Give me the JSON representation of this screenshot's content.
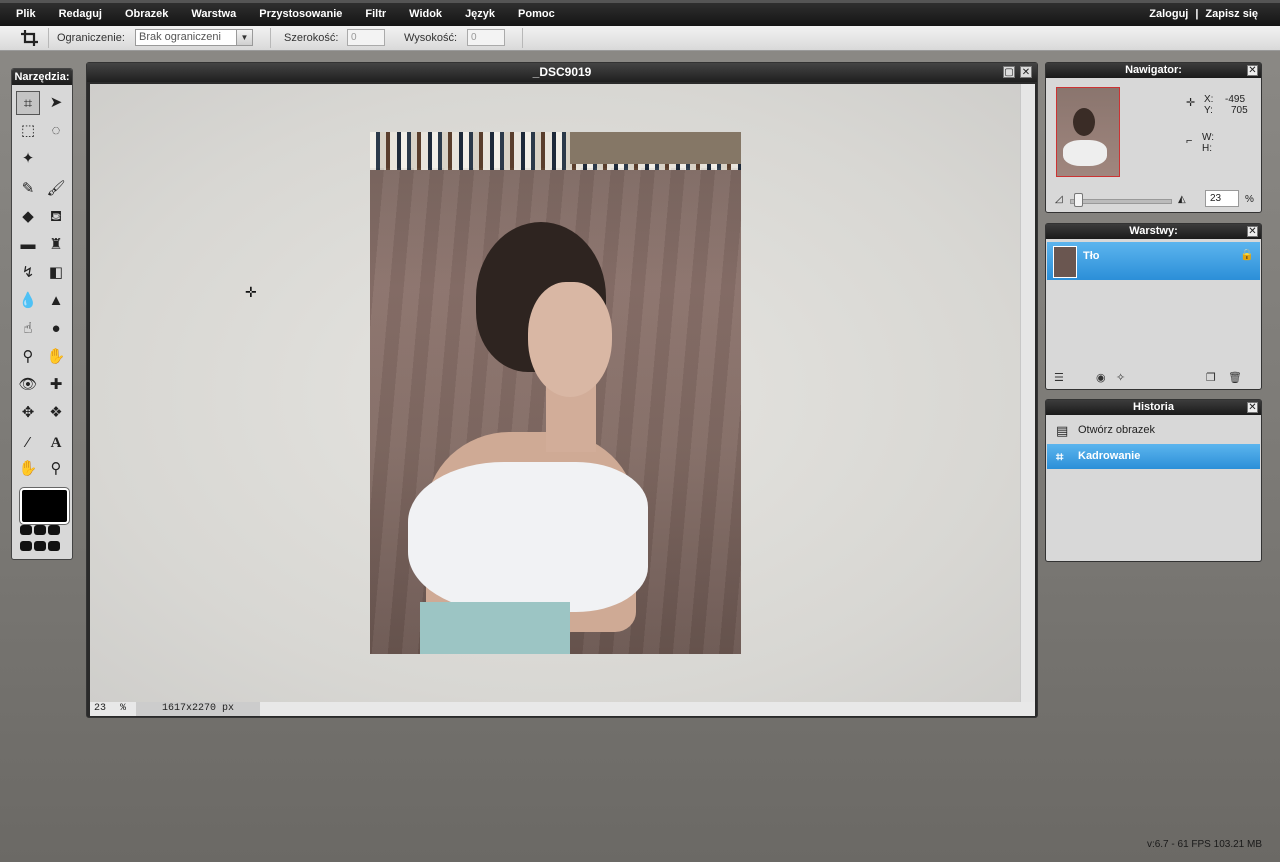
{
  "menu": {
    "items": [
      "Plik",
      "Redaguj",
      "Obrazek",
      "Warstwa",
      "Przystosowanie",
      "Filtr",
      "Widok",
      "Język",
      "Pomoc"
    ],
    "login": "Zaloguj",
    "separator": "|",
    "signup": "Zapisz się"
  },
  "options": {
    "constraint_label": "Ograniczenie:",
    "constraint_value": "Brak ograniczeni",
    "width_label": "Szerokość:",
    "width_value": "0",
    "height_label": "Wysokość:",
    "height_value": "0"
  },
  "tools": {
    "title": "Narzędzia:",
    "foreground_color": "#000000"
  },
  "document": {
    "title": "_DSC9019",
    "zoom": "23",
    "zoom_unit": "%",
    "dimensions": "1617x2270 px"
  },
  "navigator": {
    "title": "Nawigator:",
    "x_label": "X:",
    "x_value": "-495",
    "y_label": "Y:",
    "y_value": "705",
    "w_label": "W:",
    "h_label": "H:",
    "zoom": "23",
    "zoom_unit": "%"
  },
  "layers": {
    "title": "Warstwy:",
    "items": [
      {
        "name": "Tło"
      }
    ]
  },
  "history": {
    "title": "Historia",
    "items": [
      {
        "label": "Otwórz obrazek",
        "icon": "document-icon"
      },
      {
        "label": "Kadrowanie",
        "icon": "crop-icon"
      }
    ]
  },
  "version": "v:6.7 - 61 FPS 103.21 MB",
  "colors": {
    "accent": "#2b8fd8",
    "titlebar": "#1f1f1f"
  }
}
